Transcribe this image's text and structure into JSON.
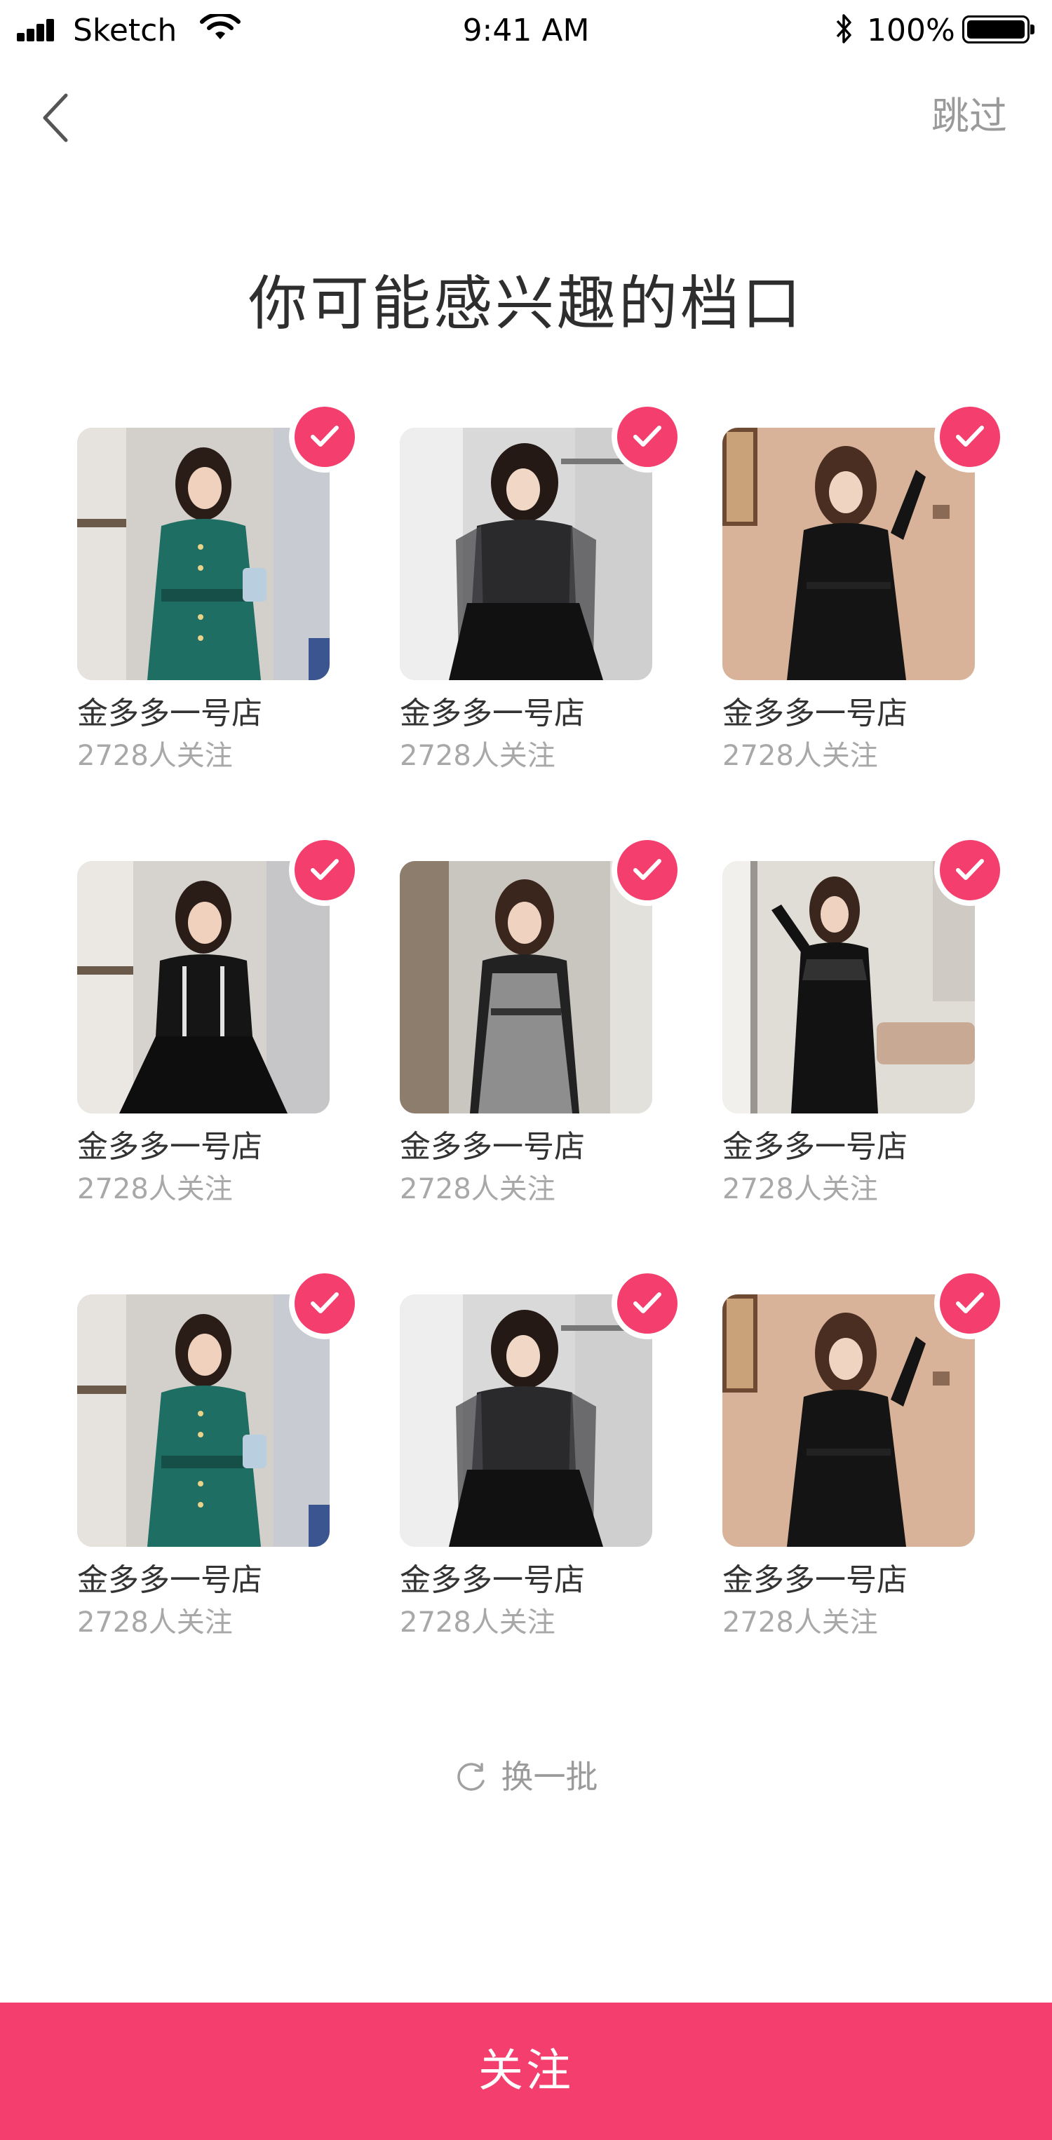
{
  "status_bar": {
    "carrier": "Sketch",
    "time": "9:41 AM",
    "battery": "100%",
    "icons": [
      "signal-icon",
      "wifi-icon",
      "bluetooth-icon",
      "battery-icon"
    ]
  },
  "nav": {
    "back_icon": "chevron-left-icon",
    "skip_label": "跳过"
  },
  "title": "你可能感兴趣的档口",
  "shops": [
    {
      "name": "金多多一号店",
      "followers": "2728人关注",
      "selected": true,
      "photo": "green-coat-dress"
    },
    {
      "name": "金多多一号店",
      "followers": "2728人关注",
      "selected": true,
      "photo": "black-lace-dress"
    },
    {
      "name": "金多多一号店",
      "followers": "2728人关注",
      "selected": true,
      "photo": "black-velvet-dress"
    },
    {
      "name": "金多多一号店",
      "followers": "2728人关注",
      "selected": true,
      "photo": "black-trim-dress"
    },
    {
      "name": "金多多一号店",
      "followers": "2728人关注",
      "selected": true,
      "photo": "grey-tweed-dress"
    },
    {
      "name": "金多多一号店",
      "followers": "2728人关注",
      "selected": true,
      "photo": "black-mesh-dress"
    },
    {
      "name": "金多多一号店",
      "followers": "2728人关注",
      "selected": true,
      "photo": "green-coat-dress"
    },
    {
      "name": "金多多一号店",
      "followers": "2728人关注",
      "selected": true,
      "photo": "black-lace-dress"
    },
    {
      "name": "金多多一号店",
      "followers": "2728人关注",
      "selected": true,
      "photo": "black-velvet-dress"
    }
  ],
  "refresh_label": "换一批",
  "follow_button": "关注",
  "colors": {
    "accent": "#f43e6d",
    "title": "#2e2e2e",
    "muted": "#9a9a9a",
    "follower_text": "#a8a8a8"
  }
}
